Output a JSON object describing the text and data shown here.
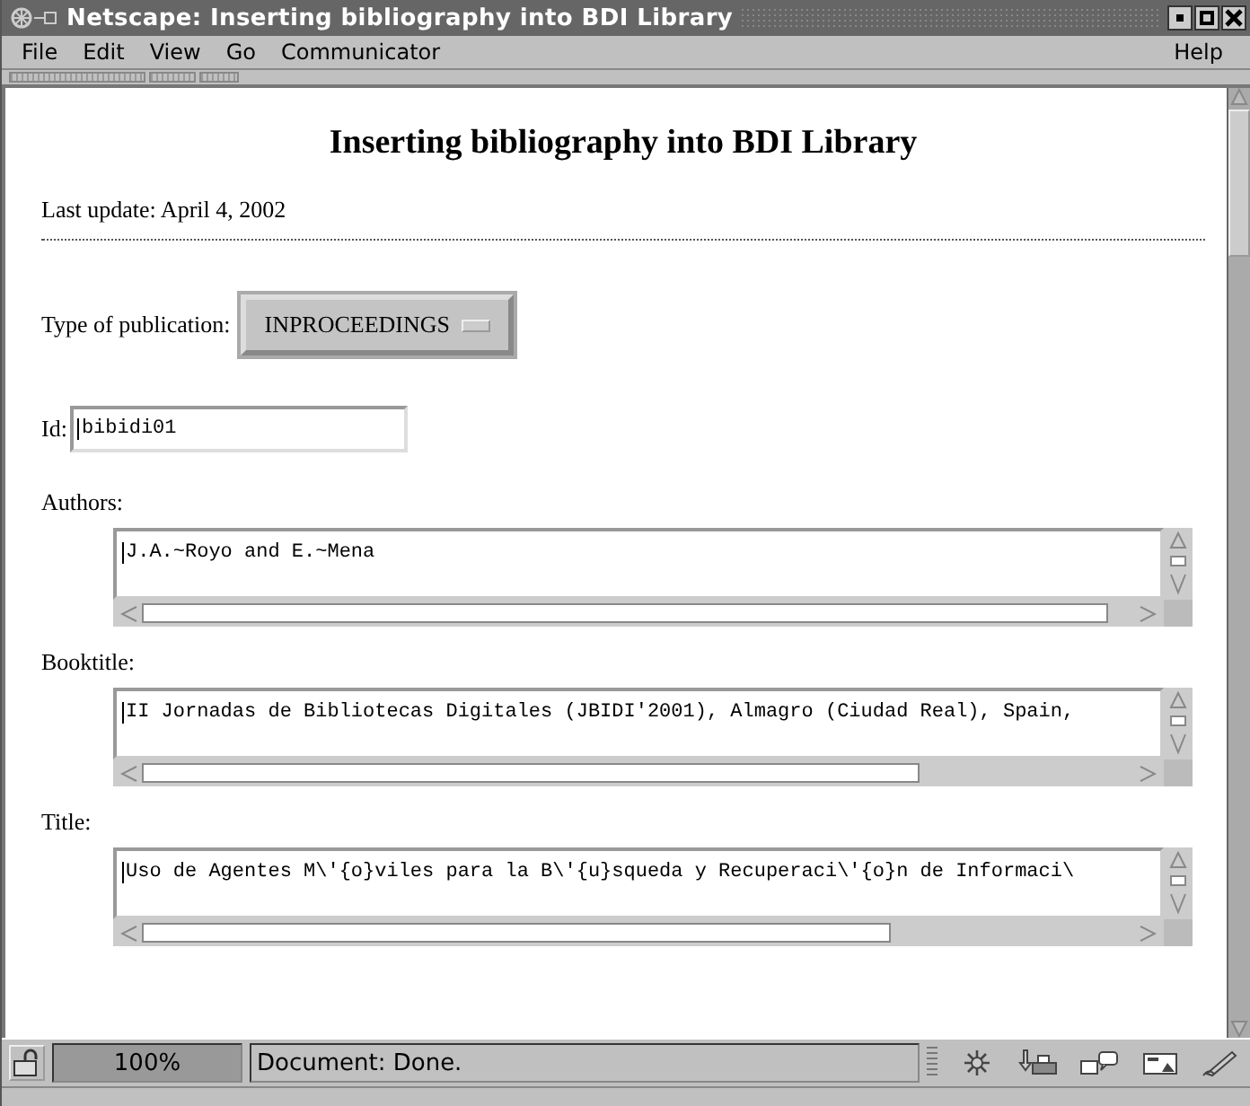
{
  "window": {
    "title": "Netscape: Inserting bibliography into BDI Library"
  },
  "menu": {
    "left": [
      "File",
      "Edit",
      "View",
      "Go",
      "Communicator"
    ],
    "right": [
      "Help"
    ]
  },
  "page": {
    "heading": "Inserting bibliography into BDI Library",
    "last_update": "Last update: April 4, 2002",
    "type_label": "Type of publication:",
    "type_value": "INPROCEEDINGS",
    "id_label": "Id:",
    "id_value": "bibidi01",
    "fields": [
      {
        "label": "Authors:",
        "value": "J.A.~Royo and E.~Mena"
      },
      {
        "label": "Booktitle:",
        "value": "II Jornadas de Bibliotecas Digitales (JBIDI'2001), Almagro (Ciudad Real), Spain,"
      },
      {
        "label": "Title:",
        "value": "Uso de Agentes M\\'{o}viles para la B\\'{u}squeda y Recuperaci\\'{o}n de Informaci\\"
      }
    ]
  },
  "status_bar": {
    "progress": "100%",
    "message": "Document: Done."
  }
}
